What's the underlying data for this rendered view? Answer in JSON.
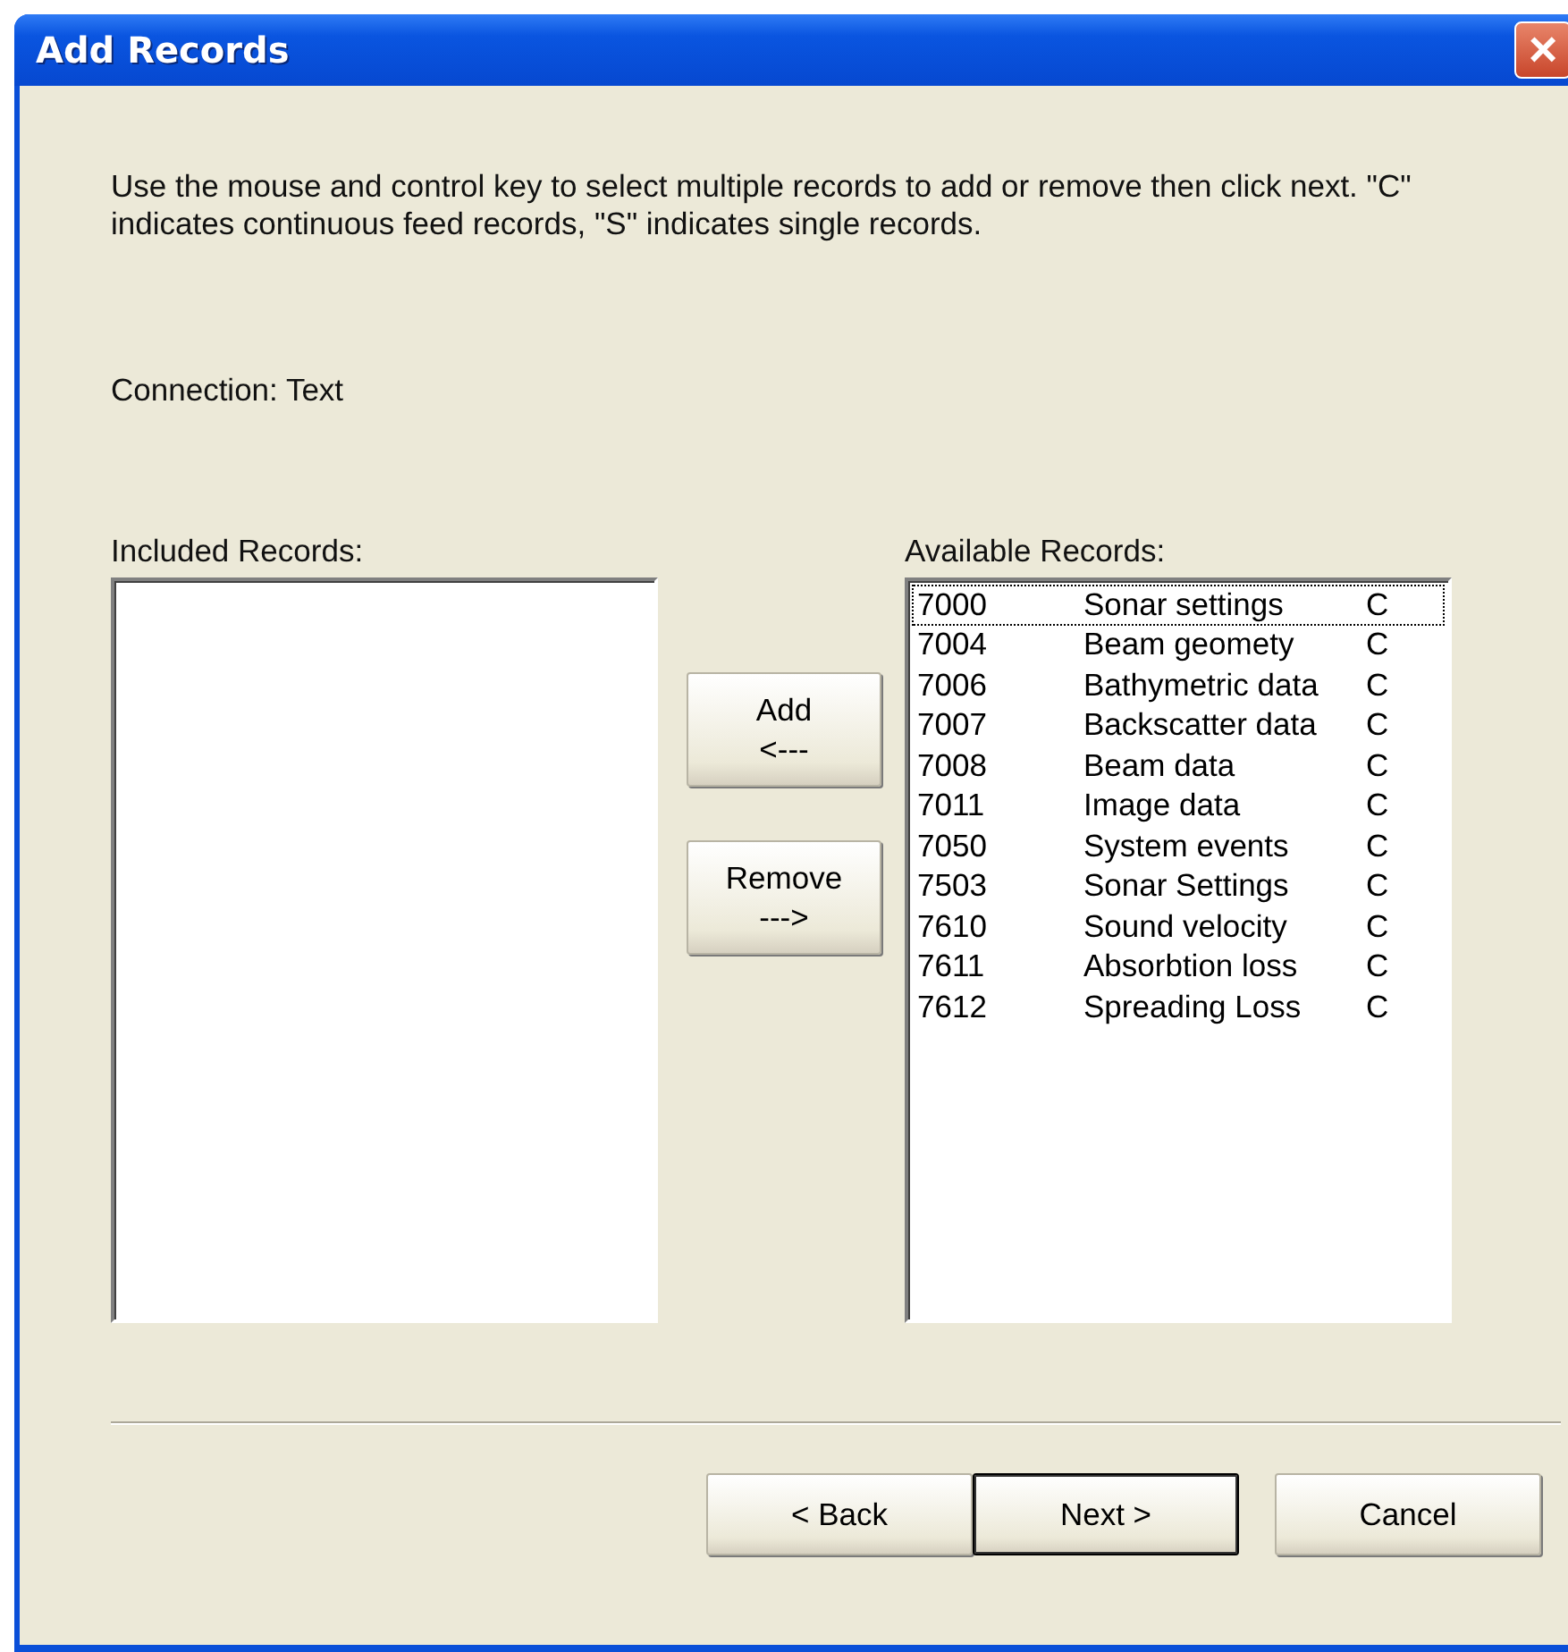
{
  "window": {
    "title": "Add Records",
    "close_button": "×"
  },
  "instructions": "Use the mouse and control key to select multiple records to add or remove  then click next.  \"C\" indicates continuous feed records, \"S\" indicates single records.",
  "connection": "Connection: Text",
  "included": {
    "label": "Included Records:"
  },
  "available": {
    "label": "Available Records:",
    "rows": [
      {
        "id": "7000",
        "name": "Sonar settings",
        "type": "C",
        "focused": true
      },
      {
        "id": "7004",
        "name": "Beam geomety",
        "type": "C",
        "focused": false
      },
      {
        "id": "7006",
        "name": "Bathymetric data",
        "type": "C",
        "focused": false
      },
      {
        "id": "7007",
        "name": "Backscatter data",
        "type": "C",
        "focused": false
      },
      {
        "id": "7008",
        "name": "Beam data",
        "type": "C",
        "focused": false
      },
      {
        "id": "7011",
        "name": "Image data",
        "type": "C",
        "focused": false
      },
      {
        "id": "7050",
        "name": "System events",
        "type": "C",
        "focused": false
      },
      {
        "id": "7503",
        "name": "Sonar Settings",
        "type": "C",
        "focused": false
      },
      {
        "id": "7610",
        "name": "Sound velocity",
        "type": "C",
        "focused": false
      },
      {
        "id": "7611",
        "name": "Absorbtion loss",
        "type": "C",
        "focused": false
      },
      {
        "id": "7612",
        "name": "Spreading Loss",
        "type": "C",
        "focused": false
      }
    ]
  },
  "add_button": {
    "label": "Add",
    "arrow": "<---"
  },
  "remove_button": {
    "label": "Remove",
    "arrow": "--->"
  },
  "footer_buttons": [
    {
      "label": "< Back",
      "default": false
    },
    {
      "label": "Next >",
      "default": true
    },
    {
      "label": "Cancel",
      "default": false
    }
  ]
}
